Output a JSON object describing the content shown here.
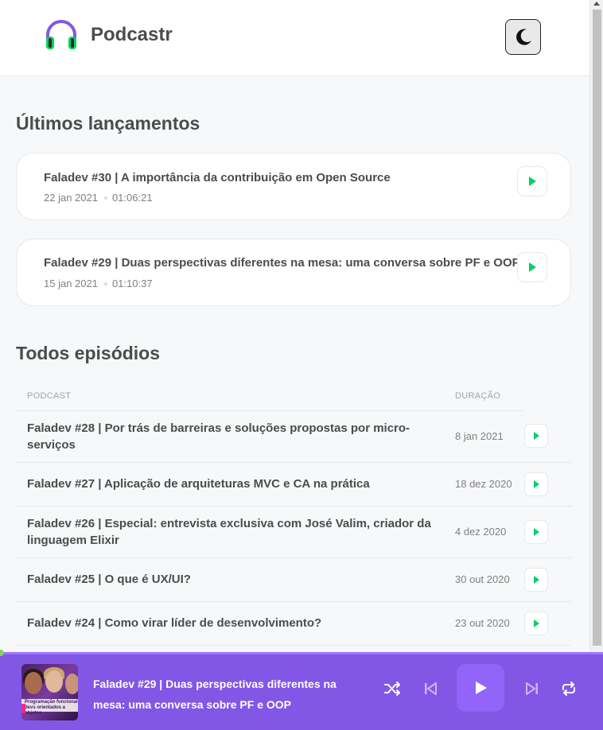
{
  "header": {
    "app_title": "Podcastr",
    "logo_icon": "headphones-icon",
    "theme_toggle_icon": "moon-icon"
  },
  "latest": {
    "section_title": "Últimos lançamentos",
    "episodes": [
      {
        "title": "Faladev #30 | A importância da contribuição em Open Source",
        "date": "22 jan 2021",
        "duration": "01:06:21"
      },
      {
        "title": "Faladev #29 | Duas perspectivas diferentes na mesa: uma conversa sobre PF e OOP",
        "date": "15 jan 2021",
        "duration": "01:10:37"
      }
    ]
  },
  "all": {
    "section_title": "Todos episódios",
    "columns": {
      "podcast": "Podcast",
      "duration": "Duração"
    },
    "episodes": [
      {
        "title": "Faladev #28 | Por trás de barreiras e soluções propostas por micro-serviços",
        "date": "8 jan 2021"
      },
      {
        "title": "Faladev #27 | Aplicação de arquiteturas MVC e CA na prática",
        "date": "18 dez 2020"
      },
      {
        "title": "Faladev #26 | Especial: entrevista exclusiva com José Valim, criador da linguagem Elixir",
        "date": "4 dez 2020"
      },
      {
        "title": "Faladev #25 | O que é UX/UI?",
        "date": "30 out 2020"
      },
      {
        "title": "Faladev #24 | Como virar líder de desenvolvimento?",
        "date": "23 out 2020"
      }
    ]
  },
  "player": {
    "now_playing_title": "Faladev #29 | Duas perspectivas diferentes na mesa: uma conversa sobre PF e OOP",
    "thumbnail_text": "Programação funcional devs orientados a objetos",
    "controls": [
      "shuffle-icon",
      "previous-icon",
      "play-icon",
      "next-icon",
      "repeat-icon"
    ],
    "accent_color": "#8257e5",
    "play_icon_color": "#04d361"
  }
}
